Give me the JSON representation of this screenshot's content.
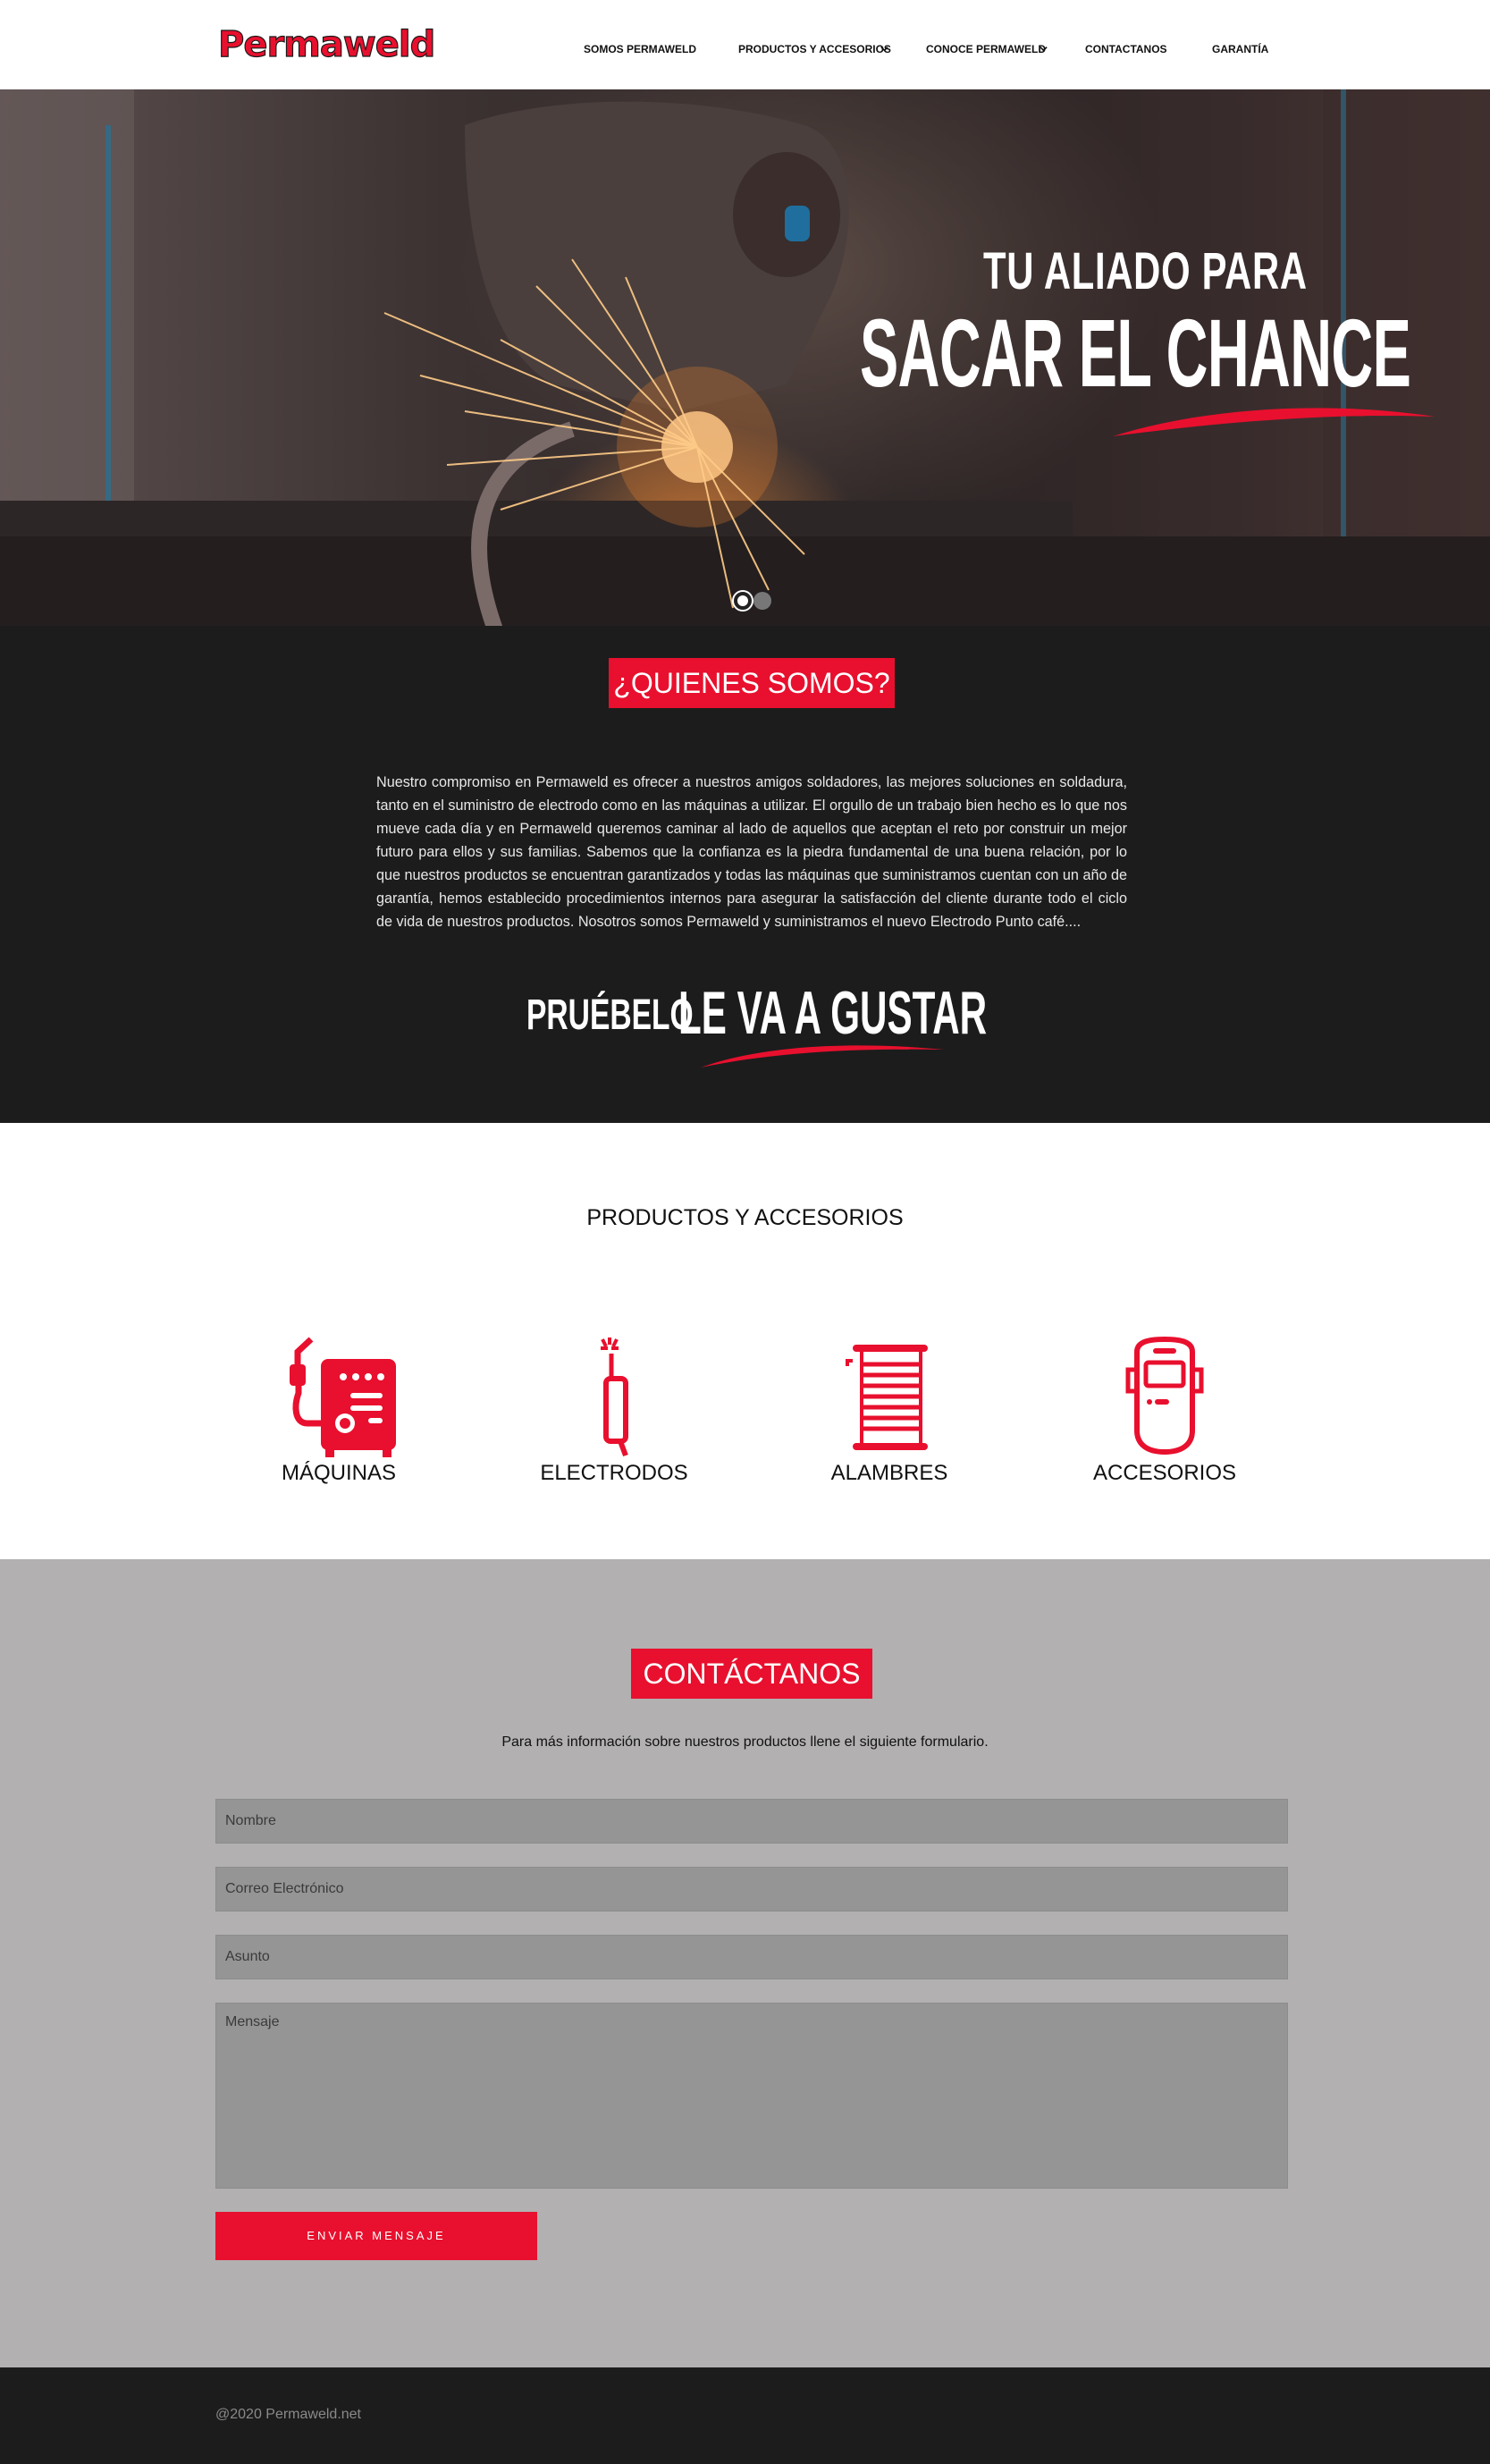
{
  "brand": {
    "name": "Permaweld",
    "accent_color": "#e8102e",
    "dark_color": "#1c1c1c"
  },
  "nav": {
    "items": [
      {
        "label": "SOMOS PERMAWELD",
        "has_dropdown": false
      },
      {
        "label": "PRODUCTOS Y ACCESORIOS",
        "has_dropdown": true
      },
      {
        "label": "CONOCE PERMAWELD",
        "has_dropdown": true
      },
      {
        "label": "CONTACTANOS",
        "has_dropdown": false
      },
      {
        "label": "GARANTÍA",
        "has_dropdown": false
      }
    ]
  },
  "hero": {
    "line1": "TU ALIADO PARA",
    "line2": "SACAR EL CHANCE",
    "slides_total": 2,
    "active_slide": 1
  },
  "about": {
    "title": "¿QUIENES SOMOS?",
    "text": "Nuestro compromiso en Permaweld es ofrecer a nuestros amigos soldadores, las mejores soluciones en soldadura, tanto en el suministro de electrodo como en las máquinas a utilizar. El orgullo de un trabajo bien hecho es lo que nos mueve cada día y en Permaweld queremos caminar al lado de aquellos que aceptan el reto por construir un mejor futuro para ellos y sus familias. Sabemos que la confianza es la piedra fundamental de una buena relación, por lo que nuestros productos se encuentran garantizados y todas las máquinas que suministramos cuentan con un año de garantía, hemos establecido procedimientos internos para asegurar la satisfacción del cliente durante todo el ciclo de vida de nuestros productos. Nosotros somos Permaweld y suministramos el nuevo Electrodo Punto café....",
    "slogan_small": "PRUÉBELO",
    "slogan_big": "LE VA A GUSTAR"
  },
  "products": {
    "title": "PRODUCTOS Y ACCESORIOS",
    "items": [
      {
        "label": "MÁQUINAS",
        "icon": "welding-machine-icon"
      },
      {
        "label": "ELECTRODOS",
        "icon": "electrode-icon"
      },
      {
        "label": "ALAMBRES",
        "icon": "wire-spool-icon"
      },
      {
        "label": "ACCESORIOS",
        "icon": "welding-helmet-icon"
      }
    ]
  },
  "contact": {
    "title": "CONTÁCTANOS",
    "subtitle": "Para más información sobre nuestros productos llene el siguiente formulario.",
    "fields": {
      "name_placeholder": "Nombre",
      "email_placeholder": "Correo Electrónico",
      "subject_placeholder": "Asunto",
      "message_placeholder": "Mensaje"
    },
    "submit_label": "ENVIAR MENSAJE"
  },
  "footer": {
    "copyright": "@2020 Permaweld.net"
  }
}
